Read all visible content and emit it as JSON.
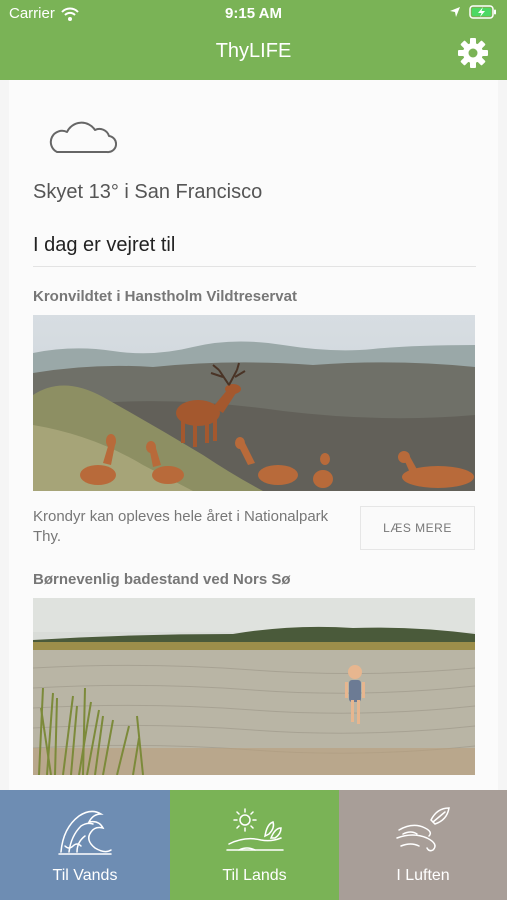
{
  "status_bar": {
    "carrier": "Carrier",
    "time": "9:15 AM",
    "icons": [
      "wifi-icon",
      "location-arrow-icon",
      "battery-charging-icon"
    ]
  },
  "nav": {
    "title": "ThyLIFE",
    "settings_icon": "gear-icon"
  },
  "colors": {
    "brand_green": "#7ab356",
    "tab_water": "#6e8db3",
    "tab_land": "#7ab356",
    "tab_air": "#a89e98"
  },
  "weather": {
    "icon": "cloud-icon",
    "text": "Skyet 13° i San Francisco",
    "heading": "I dag er vejret til"
  },
  "articles": [
    {
      "title": "Kronvildtet i Hanstholm Vildtreservat",
      "image": "red-deer-photo",
      "description": "Krondyr kan opleves hele året i Nationalpark Thy.",
      "button": "LÆS MERE"
    },
    {
      "title": "Børnevenlig badestand ved Nors Sø",
      "image": "lake-child-photo"
    }
  ],
  "tabs": [
    {
      "label": "Til Vands",
      "icon": "wave-icon"
    },
    {
      "label": "Til Lands",
      "icon": "sun-landscape-icon"
    },
    {
      "label": "I Luften",
      "icon": "wind-leaf-icon"
    }
  ]
}
